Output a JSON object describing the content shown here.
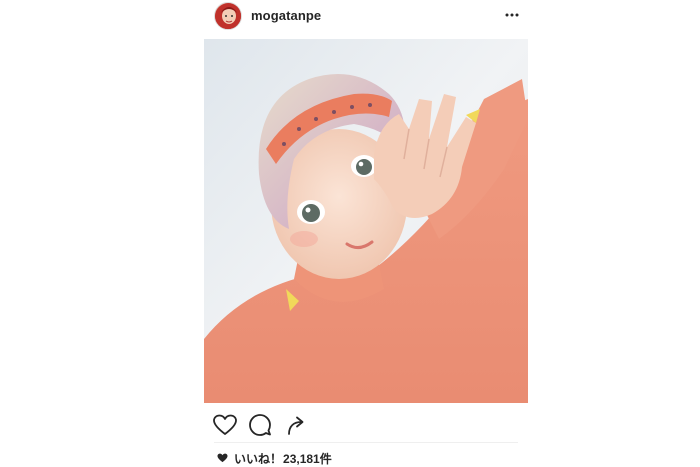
{
  "post": {
    "username": "mogatanpe",
    "likes_label": "いいね！",
    "likes_count": "23,181件"
  },
  "icons": {
    "more": "more-options-icon",
    "like": "heart-icon",
    "comment": "comment-icon",
    "share": "share-icon"
  },
  "colors": {
    "text": "#262626",
    "icon": "#262626",
    "background": "#ffffff"
  }
}
